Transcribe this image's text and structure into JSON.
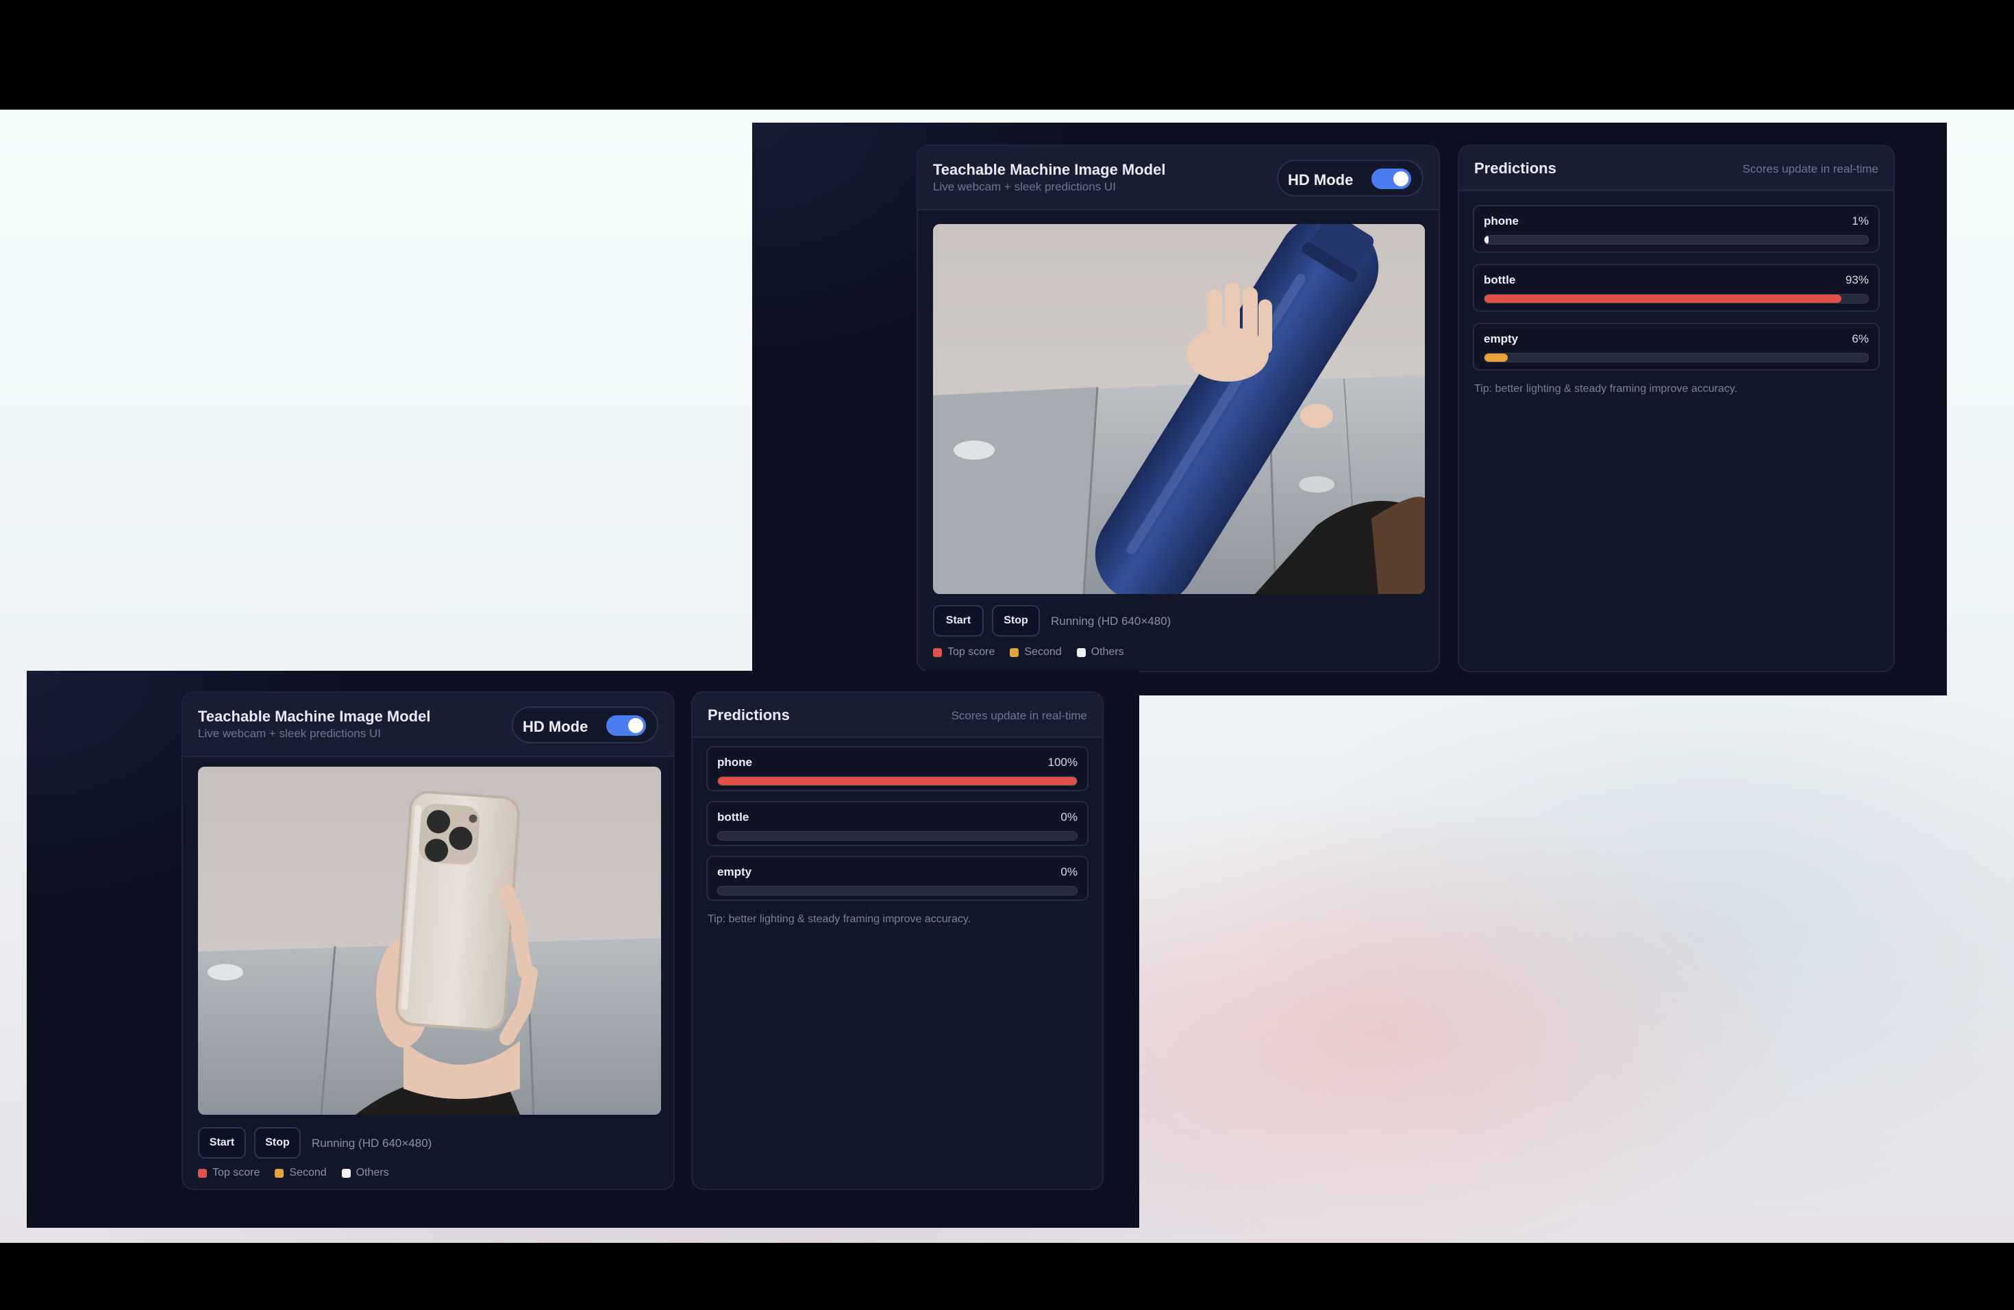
{
  "screens": [
    {
      "app": {
        "title": "Teachable Machine Image Model",
        "subtitle": "Live webcam + sleek predictions UI"
      },
      "hd_mode": {
        "label": "HD Mode",
        "enabled": true
      },
      "controls": {
        "start_label": "Start",
        "stop_label": "Stop",
        "status": "Running (HD 640×480)"
      },
      "legend": [
        {
          "label": "Top score",
          "color": "#e0514a"
        },
        {
          "label": "Second",
          "color": "#e9a23b"
        },
        {
          "label": "Others",
          "color": "#f2f2f2"
        }
      ],
      "predictions": {
        "title": "Predictions",
        "subtitle": "Scores update in real-time",
        "items": [
          {
            "label": "phone",
            "pct": "1%",
            "value": 0.01,
            "color": "#f2f2f2"
          },
          {
            "label": "bottle",
            "pct": "93%",
            "value": 0.93,
            "color": "#e0514a"
          },
          {
            "label": "empty",
            "pct": "6%",
            "value": 0.06,
            "color": "#e9a23b"
          }
        ],
        "tip": "Tip: better lighting & steady framing improve accuracy."
      },
      "camera_subject": "bottle"
    },
    {
      "app": {
        "title": "Teachable Machine Image Model",
        "subtitle": "Live webcam + sleek predictions UI"
      },
      "hd_mode": {
        "label": "HD Mode",
        "enabled": true
      },
      "controls": {
        "start_label": "Start",
        "stop_label": "Stop",
        "status": "Running (HD 640×480)"
      },
      "legend": [
        {
          "label": "Top score",
          "color": "#e0514a"
        },
        {
          "label": "Second",
          "color": "#e9a23b"
        },
        {
          "label": "Others",
          "color": "#f2f2f2"
        }
      ],
      "predictions": {
        "title": "Predictions",
        "subtitle": "Scores update in real-time",
        "items": [
          {
            "label": "phone",
            "pct": "100%",
            "value": 1.0,
            "color": "#e0514a"
          },
          {
            "label": "bottle",
            "pct": "0%",
            "value": 0.0,
            "color": "#e9a23b"
          },
          {
            "label": "empty",
            "pct": "0%",
            "value": 0.0,
            "color": "#f2f2f2"
          }
        ],
        "tip": "Tip: better lighting & steady framing improve accuracy."
      },
      "camera_subject": "phone"
    }
  ]
}
